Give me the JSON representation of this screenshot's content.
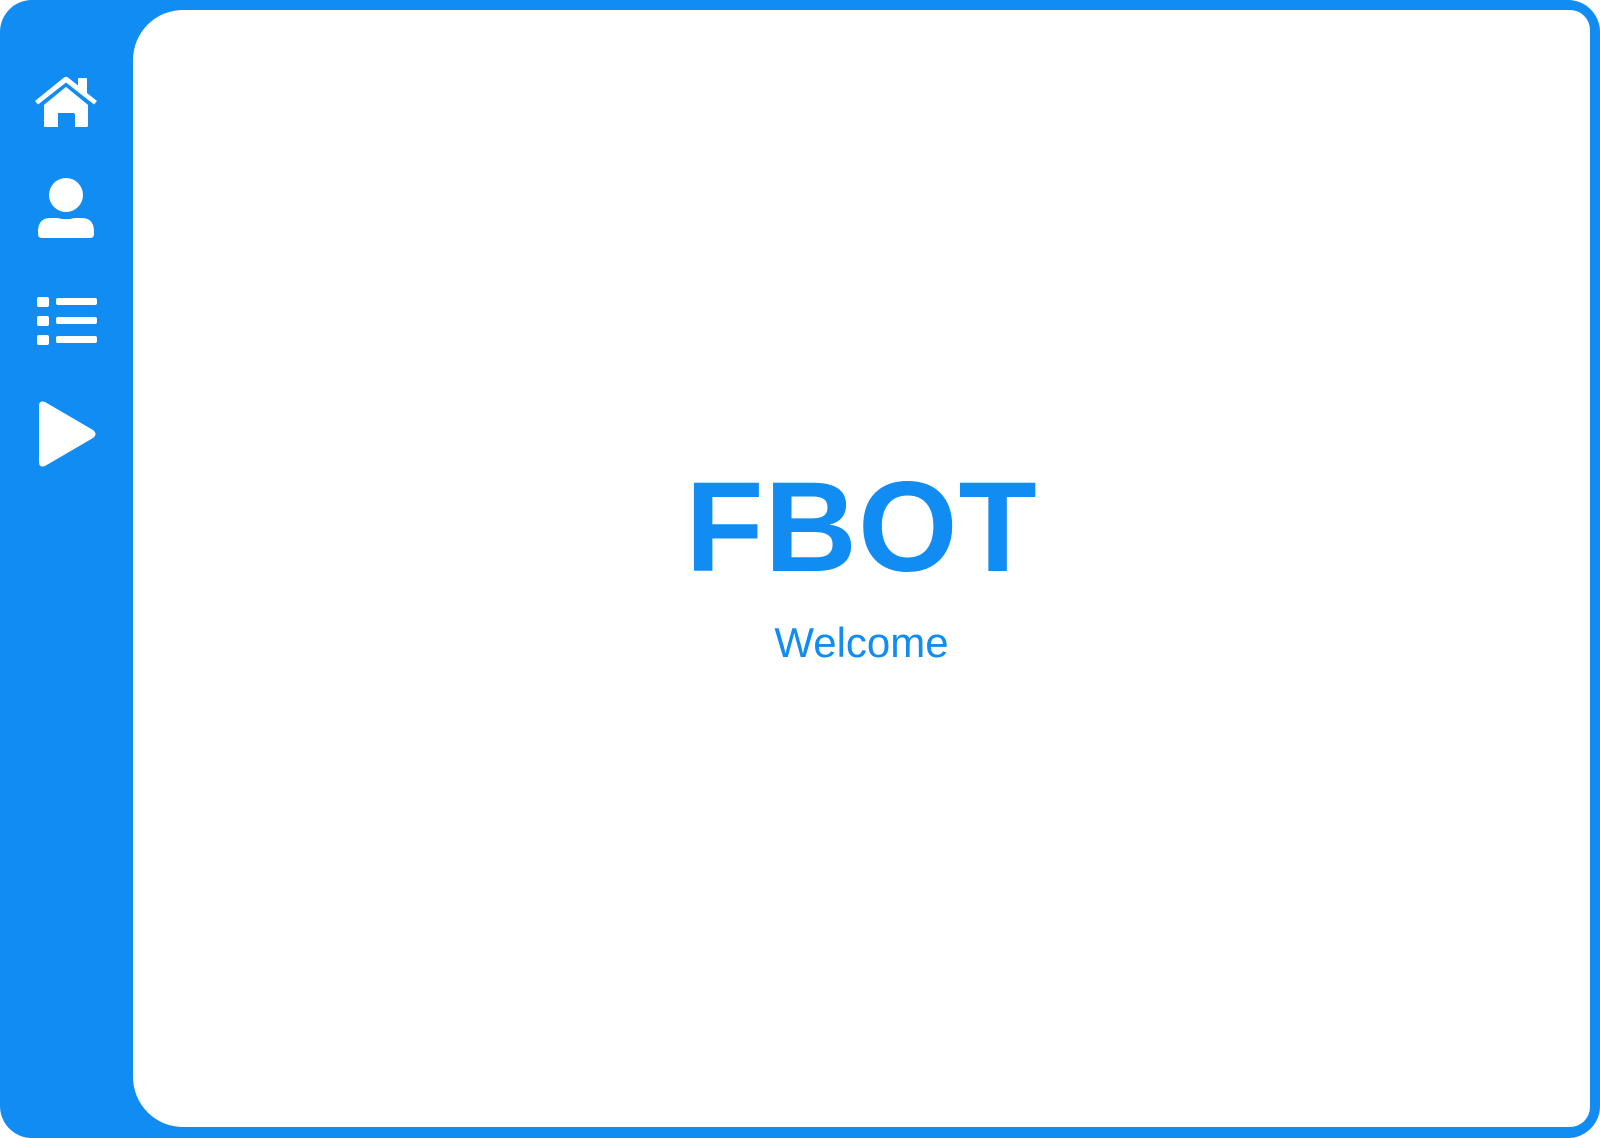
{
  "theme": {
    "accent": "#118cf3",
    "background": "#ffffff",
    "icon_color": "#ffffff"
  },
  "sidebar": {
    "items": [
      {
        "icon": "home-icon"
      },
      {
        "icon": "user-icon"
      },
      {
        "icon": "list-icon"
      },
      {
        "icon": "play-icon"
      }
    ]
  },
  "main": {
    "title": "FBOT",
    "subtitle": "Welcome"
  }
}
